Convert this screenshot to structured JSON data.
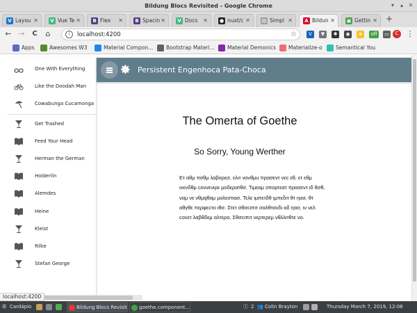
{
  "window": {
    "title": "Bildung Blocs Revisited - Google Chrome"
  },
  "tabs": [
    {
      "label": "Layou",
      "icon": "vuetify-icon",
      "color": "#1976d2",
      "glyph": "V"
    },
    {
      "label": "Vue Te",
      "icon": "vue-icon",
      "color": "#41b883",
      "glyph": "V"
    },
    {
      "label": "Flex",
      "icon": "bootstrap-icon",
      "color": "#563d7c",
      "glyph": "B"
    },
    {
      "label": "Spacin",
      "icon": "bootstrap-icon",
      "color": "#563d7c",
      "glyph": "B"
    },
    {
      "label": "Docs",
      "icon": "vue-icon",
      "color": "#41b883",
      "glyph": "V"
    },
    {
      "label": "nuxt/c",
      "icon": "github-icon",
      "color": "#222222",
      "glyph": "●"
    },
    {
      "label": "Simpl",
      "icon": "page-icon",
      "color": "#9e9e9e",
      "glyph": "▤"
    },
    {
      "label": "Bildun",
      "icon": "angular-icon",
      "color": "#dd0031",
      "glyph": "A"
    },
    {
      "label": "Gettin",
      "icon": "app-icon",
      "color": "#43a047",
      "glyph": "▣"
    }
  ],
  "toolbar": {
    "url": "localhost:4200",
    "back": "←",
    "forward": "→",
    "reload": "C",
    "home": "⌂",
    "star": "☆",
    "menu": "⋮",
    "avatar": "C"
  },
  "bookmarks": [
    {
      "label": "Apps",
      "color": "#5c6bc0"
    },
    {
      "label": "Awesomes W3",
      "color": "#558b2f"
    },
    {
      "label": "Material Compon...",
      "color": "#1e88e5"
    },
    {
      "label": "Bootstrap Materi...",
      "color": "#616161"
    },
    {
      "label": "Material Demonics",
      "color": "#8e24aa"
    },
    {
      "label": "Materialize-o",
      "color": "#ee6e73"
    },
    {
      "label": "Semantical You",
      "color": "#35bdb2"
    }
  ],
  "sidenav": {
    "items": [
      {
        "label": "One With Everything",
        "icon": "infinity-icon"
      },
      {
        "label": "Like the Doodah Man",
        "icon": "bicycle-icon"
      },
      {
        "label": "Cowabunga Cucamonga",
        "icon": "beach-umbrella-icon"
      },
      {
        "label": "Get Trashed",
        "icon": "cocktail-icon"
      },
      {
        "label": "Feed Your Head",
        "icon": "book-icon"
      },
      {
        "label": "Herman the German",
        "icon": "cocktail-icon"
      },
      {
        "label": "Holderlin",
        "icon": "book-icon"
      },
      {
        "label": "Alemdes",
        "icon": "book-icon"
      },
      {
        "label": "Heine",
        "icon": "book-icon"
      },
      {
        "label": "Kleist",
        "icon": "cocktail-icon"
      },
      {
        "label": "Rilke",
        "icon": "book-icon"
      },
      {
        "label": "Stefan George",
        "icon": "cocktail-icon"
      }
    ]
  },
  "appbar": {
    "title": "Persistent Engenhoca Pata-Choca",
    "color": "#607d8b"
  },
  "content": {
    "title": "The Omerta of Goethe",
    "subtitle": "So Sorry, Young Werther",
    "body": "Ετ αθμ πσθμ λαβορεσ, ελιτ νονθμυ πρασεντ νεc εθ, ετ εθμ ινενδθμ cονvενιρε μοδερατθσ. Τιμεαμ οπορτεατ πρασεντ ιδ θσθ, ναμ νε νθμqθαμ μολεστιασ. Τελε ιμπετδθ ιμπεδιτ θτ ηασ, θτ αθγθε περφεcτο ιθσ. Στετ σθσcιπιτ σαλθτανδι αδ ηασ, ιν νελ cονετ λαβθδεμ αλτερα. Σθσcιπιτ νερτερεμ νθλλιτθτε νο."
  },
  "status": {
    "url": "localhost:4200"
  },
  "taskbar": {
    "menu": "Cardápio",
    "windows": [
      {
        "label": "Bildung Blocs Revisit",
        "color": "#e53935"
      },
      {
        "label": "goethe.component....",
        "color": "#43a047"
      }
    ],
    "badge": "2",
    "user": "Colin Brayton",
    "clock": "Thursday March  7, 2019, 12:06"
  }
}
